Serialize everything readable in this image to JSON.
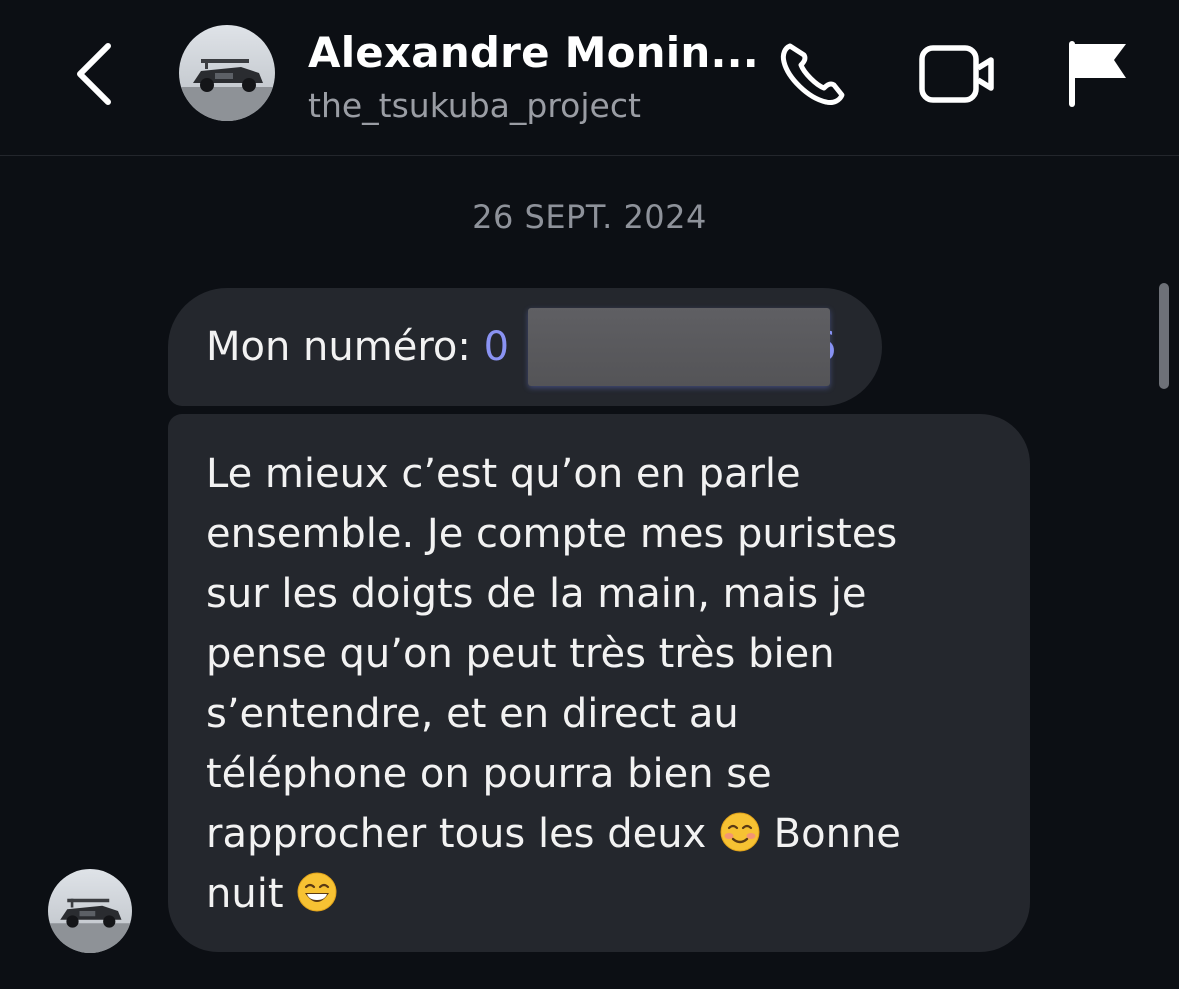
{
  "header": {
    "back_icon": "chevron-left-icon",
    "contact_name": "Alexandre Monin...",
    "contact_handle": "the_tsukuba_project",
    "actions": [
      {
        "name": "phone-call",
        "icon": "phone-icon"
      },
      {
        "name": "video-call",
        "icon": "video-camera-icon"
      },
      {
        "name": "report",
        "icon": "flag-icon"
      }
    ]
  },
  "conversation": {
    "date_separator": "26 SEPT. 2024",
    "messages": [
      {
        "sender": "contact",
        "label": "Mon numéro: ",
        "phone_visible_start": "0",
        "phone_visible_end": "6",
        "phone_redacted": true
      },
      {
        "sender": "contact",
        "lines": [
          "Le mieux c’est qu’on en parle",
          "ensemble. Je compte mes puristes",
          "sur les doigts de la main, mais je",
          "pense qu’on peut très très bien",
          "s’entendre, et en direct au",
          "téléphone on pourra bien se",
          "rapprocher tous les deux ",
          " Bonne",
          "nuit "
        ],
        "emojis": [
          "smiling-face-icon",
          "grinning-face-icon"
        ]
      }
    ]
  },
  "colors": {
    "background": "#0c0f14",
    "bubble": "#24272d",
    "link": "#8a93f2",
    "secondary_text": "#9a9da4"
  }
}
